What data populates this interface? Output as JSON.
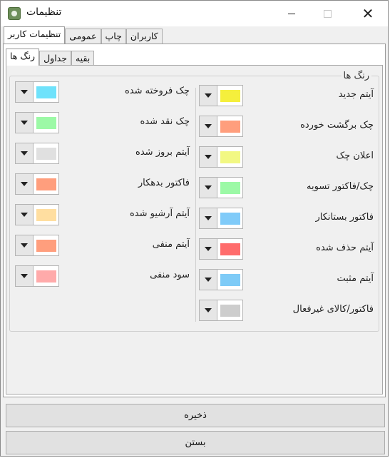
{
  "window": {
    "title": "تنظیمات"
  },
  "outer_tabs": [
    {
      "label": "تنظیمات کاربر",
      "active": true
    },
    {
      "label": "عمومی",
      "active": false
    },
    {
      "label": "چاپ",
      "active": false
    },
    {
      "label": "کاربران",
      "active": false
    }
  ],
  "inner_tabs": [
    {
      "label": "رنگ ها",
      "active": true
    },
    {
      "label": "جداول",
      "active": false
    },
    {
      "label": "بقیه",
      "active": false
    }
  ],
  "group": {
    "title": "رنگ ها"
  },
  "right_column": [
    {
      "label": "آیتم جدید",
      "color": "#f5ef3c"
    },
    {
      "label": "چک برگشت خورده",
      "color": "#ff9e7d"
    },
    {
      "label": "اعلان چک",
      "color": "#f2f883"
    },
    {
      "label": "چک/فاکتور تسویه",
      "color": "#9cf9a6"
    },
    {
      "label": "فاکتور بستانکار",
      "color": "#80cbf9"
    },
    {
      "label": "آیتم حذف شده",
      "color": "#ff6c6c"
    },
    {
      "label": "آیتم مثبت",
      "color": "#7ecbf7"
    },
    {
      "label": "فاکتور/کالای غیرفعال",
      "color": "#cdcdcd"
    }
  ],
  "left_column": [
    {
      "label": "چک فروخته شده",
      "color": "#6fe2fb"
    },
    {
      "label": "چک نقد شده",
      "color": "#9cf9a6"
    },
    {
      "label": "آیتم بروز شده",
      "color": "#e0e0e0"
    },
    {
      "label": "فاکتور بدهکار",
      "color": "#ff9e7d"
    },
    {
      "label": "آیتم آرشیو شده",
      "color": "#ffdea0"
    },
    {
      "label": "آیتم منفی",
      "color": "#ff9e7d"
    },
    {
      "label": "سود منفی",
      "color": "#ffaaaa"
    }
  ],
  "buttons": {
    "save": "ذخیره",
    "close": "بستن"
  }
}
